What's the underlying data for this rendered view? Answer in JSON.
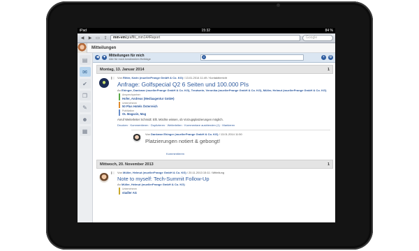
{
  "status": {
    "left": "iPad",
    "time": "15:32",
    "battery": "84 %"
  },
  "browser": {
    "url_host": "mm-vm",
    "url_path": "/graffiti_mm14#Report",
    "search_placeholder": "Google"
  },
  "app": {
    "title": "Mitteilungen"
  },
  "filter": {
    "title": "Mitteilungen für mich",
    "subtitle": "Alle für mich bestimmten Beiträge"
  },
  "groups": [
    {
      "date": "Montag, 13. Januar 2014",
      "count": "1",
      "message": {
        "from_prefix": "Von",
        "from": "Ritter, Karin (muellerPrange GmbH & Co. KG)",
        "meta": "/ 13.01.2014 11:49 / Kontaktbericht",
        "subject": "Anfrage: Golfspecial Q2 6 Seiten und 100.000 PIs",
        "to_prefix": "An",
        "to": "Ehinger, Dankmar (muellerPrange GmbH & Co. KG), Treutwein, Veronika (muellerPrange GmbH & Co. KG), Müller, Helmut (muellerPrange GmbH & Co. KG)",
        "tags": [
          {
            "label": "Ansprechpartner",
            "value": "Hofer, Andreas (Mediaagentur GmbH)",
            "color": "#5aa845"
          },
          {
            "label": "Unternehmen",
            "value": "50 Plus Hotels Österreich",
            "color": "#e08a2c"
          },
          {
            "label": "Publikation",
            "value": "OL Magazin, Mag",
            "color": "#6a8ec9"
          }
        ],
        "body": "Anruf Weiterleiter Schmidt: Ellt. Möchte wissen, ob Vorzugsplatzierungen möglich.",
        "actions": "Drucken · Kommentieren · Duplizieren · Weiterleiten · Kommentare ausblenden (1) · Markieren",
        "reply": {
          "from_prefix": "Von",
          "from": "Dankmar Ehinger (muellerPrange GmbH & Co. KG)",
          "meta": "/ 13.01.2014 11:50",
          "text": "Platzierungen notiert & gebongt!",
          "link": "Kommentieren"
        }
      }
    },
    {
      "date": "Mittwoch, 20. November 2013",
      "count": "1",
      "message": {
        "from_prefix": "Von",
        "from": "Müller, Helmut (muellerPrange GmbH & Co. KG)",
        "meta": "/ 20.11.2013 15:11 / Mitteilung",
        "subject": "Note to myself: Tech-Summit Follow-Up",
        "to_prefix": "An",
        "to": "Müller, Helmut (muellerPrange GmbH & Co. KG)",
        "tags": [
          {
            "label": "Unternehmen",
            "value": "stadler AG",
            "color": "#c9a82c"
          }
        ]
      }
    }
  ]
}
